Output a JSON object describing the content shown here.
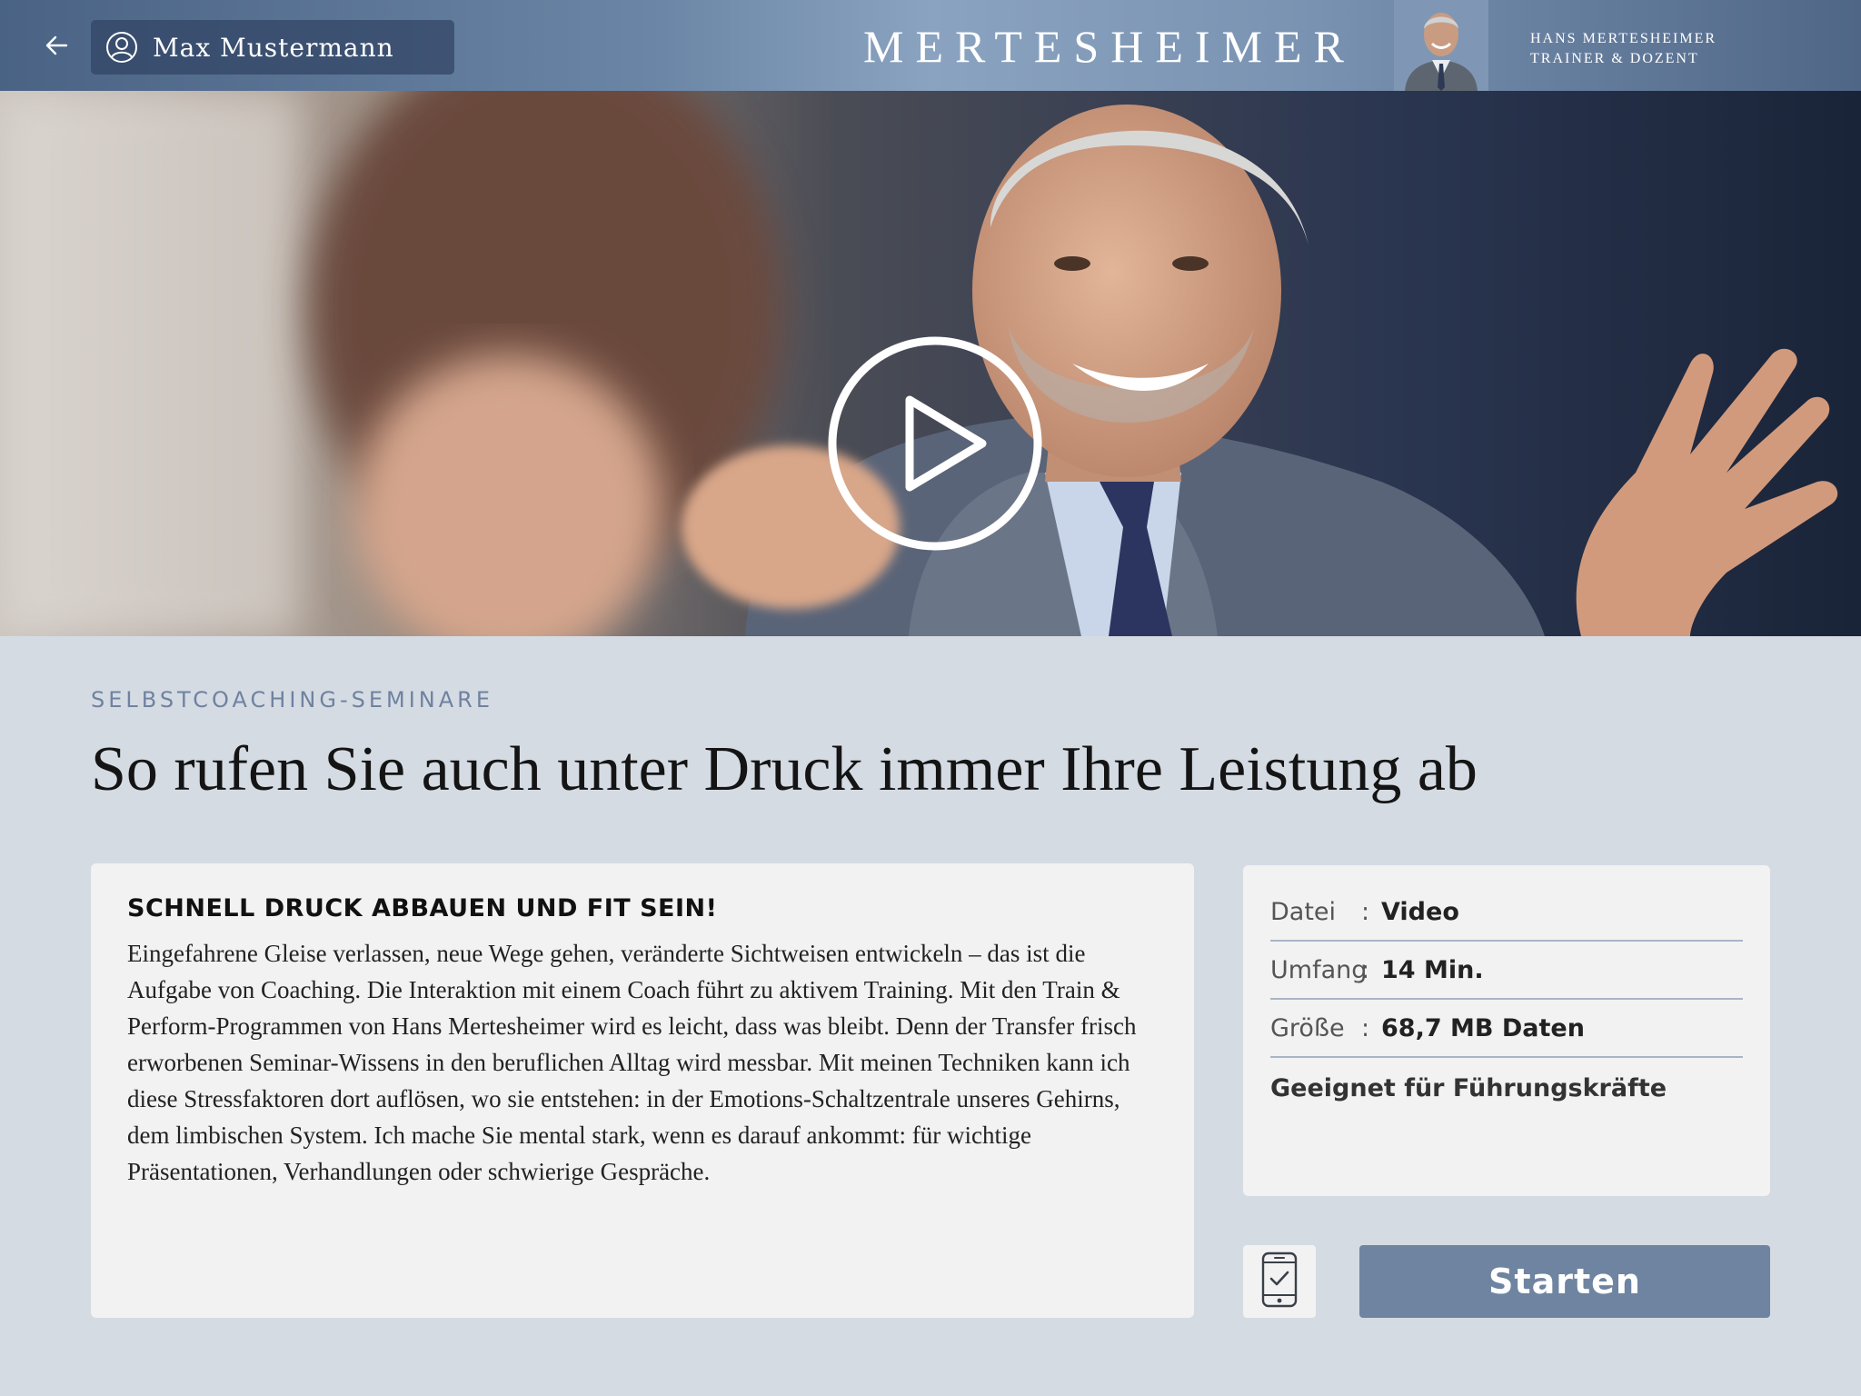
{
  "header": {
    "user_name": "Max Mustermann",
    "brand": "MERTESHEIMER",
    "trainer_name": "HANS MERTESHEIMER",
    "trainer_role": "TRAINER & DOZENT",
    "icons": [
      "back-arrow-icon",
      "user-icon"
    ]
  },
  "hero": {
    "icon": "play-icon"
  },
  "content": {
    "category": "SELBSTCOACHING-SEMINARE",
    "title": "So rufen Sie auch unter Druck immer Ihre Leistung ab",
    "description_heading": "SCHNELL DRUCK ABBAUEN UND FIT SEIN!",
    "description": "Eingefahrene Gleise verlassen, neue Wege gehen, veränderte Sichtweisen entwickeln – das ist die Aufgabe von Coaching. Die Interaktion mit einem Coach führt zu aktivem Training. Mit den Train & Perform-Programmen von Hans Mertesheimer wird es leicht, dass was bleibt. Denn der Transfer frisch erworbenen Seminar-Wissens in den beruflichen Alltag wird messbar. Mit meinen Techniken kann ich diese Stressfaktoren dort auflösen, wo sie entstehen: in der Emotions-Schaltzentrale unseres Gehirns, dem limbischen System. Ich mache Sie mental stark, wenn es darauf ankommt: für wichtige Präsentationen, Verhandlungen oder schwierige Gespräche."
  },
  "meta": {
    "rows": [
      {
        "key": "Datei",
        "sep": ":",
        "value": "Video"
      },
      {
        "key": "Umfang",
        "sep": ":",
        "value": "14 Min."
      },
      {
        "key": "Größe",
        "sep": ":",
        "value": "68,7 MB Daten"
      }
    ],
    "note": "Geeignet für Führungskräfte"
  },
  "actions": {
    "start_label": "Starten",
    "device_icon": "phone-check-icon"
  },
  "colors": {
    "background": "#d5dbe3",
    "header": "#6b85a6",
    "accent": "#6e84a1",
    "category": "#6f82a0",
    "card": "#f2f2f3"
  }
}
